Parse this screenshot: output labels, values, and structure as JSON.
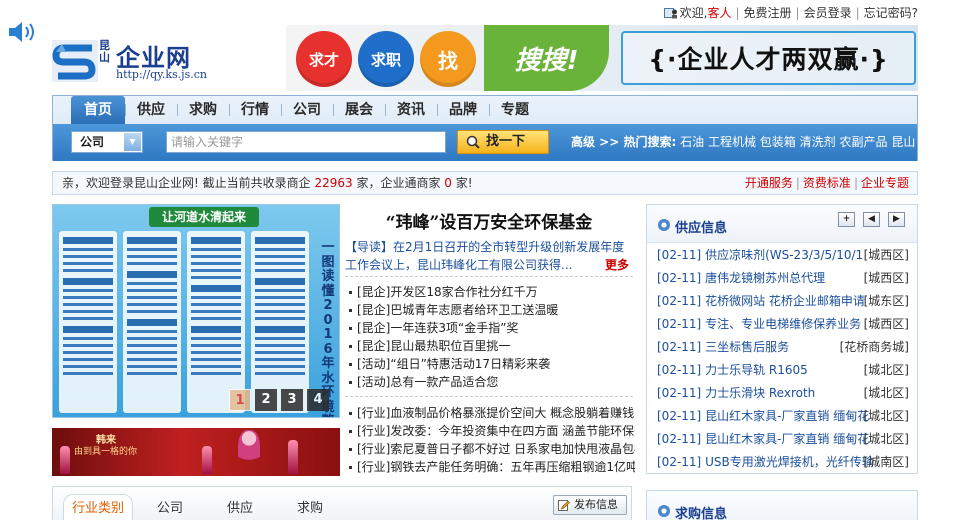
{
  "toplinks": {
    "welcome": "欢迎,",
    "guest": "客人",
    "register": "免费注册",
    "login": "会员登录",
    "forgot": "忘记密码?"
  },
  "logo": {
    "cn_small": "昆山",
    "cn_big": "企业网",
    "url": "http://qy.ks.js.cn"
  },
  "banner": {
    "c1": "求才",
    "c2": "求职",
    "c3": "找",
    "big": "搜搜!",
    "slogan": "{·企业人才两双赢·}"
  },
  "nav": {
    "tabs": [
      "首页",
      "供应",
      "求购",
      "行情",
      "公司",
      "展会",
      "资讯",
      "品牌",
      "专题"
    ],
    "select_value": "公司",
    "search_placeholder": "请输入关键字",
    "search_button": "找一下",
    "hot_label": "高级 >> 热门搜索:",
    "hot_keywords": [
      "石油",
      "工程机械",
      "包装箱",
      "清洗剂",
      "农副产品",
      "昆山"
    ]
  },
  "welcome": {
    "text1": "亲，欢迎登录昆山企业网!  截止当前共收录商企 ",
    "count1": "22963",
    "text2": " 家，企业通商家 ",
    "count2": "0",
    "text3": " 家!",
    "link1": "开通服务",
    "link2": "资费标准",
    "link3": "企业专题"
  },
  "photo": {
    "title": "让河道水清起来",
    "vertical": "一图读懂2016年水环境整治",
    "pages": [
      "1",
      "2",
      "3",
      "4"
    ]
  },
  "ad": {
    "t1": "韩来",
    "t2": "由到具一格的你"
  },
  "news": {
    "headline": "“玮峰”设百万安全环保基金",
    "lead_tag": "【导读】",
    "lead": "在2月1日召开的全市转型升级创新发展年度工作会议上，昆山玮峰化工有限公司获得...",
    "more": "更多",
    "list1": [
      "[昆企]开发区18家合作社分红千万",
      "[昆企]巴城青年志愿者给环卫工送温暖",
      "[昆企]一年连获3项“金手指”奖",
      "[昆企]昆山最热职位百里挑一",
      "[活动]“组日”特惠活动17日精彩来袭",
      "[活动]总有一款产品适合您"
    ],
    "list2": [
      "[行业]血液制品价格暴涨提价空间大 概念股躺着赚钱",
      "[行业]发改委：今年投资集中在四方面 涵盖节能环保等",
      "[行业]索尼夏普日子都不好过 日系家电加快甩液晶包袱",
      "[行业]钢铁去产能任务明确：五年再压缩粗钢逾1亿吨"
    ]
  },
  "bottom_tabs": {
    "tabs": [
      "行业类别",
      "公司",
      "供应",
      "求购"
    ],
    "post": "发布信息"
  },
  "supply": {
    "title": "供应信息",
    "controls": [
      "+",
      "◀",
      "▶"
    ],
    "rows": [
      {
        "date": "[02-11]",
        "title": "供应凉味剂(WS-23/3/5/10/1",
        "area": "[城西区]"
      },
      {
        "date": "[02-11]",
        "title": "唐伟龙镜榭苏州总代理",
        "area": "[城西区]"
      },
      {
        "date": "[02-11]",
        "title": "花桥微网站 花桥企业邮箱申请",
        "area": "[城东区]"
      },
      {
        "date": "[02-11]",
        "title": "专注、专业电梯维修保养业务",
        "area": "[城西区]"
      },
      {
        "date": "[02-11]",
        "title": "三坐标售后服务",
        "area": "[花桥商务城]"
      },
      {
        "date": "[02-11]",
        "title": "力士乐导轨 R1605",
        "area": "[城北区]"
      },
      {
        "date": "[02-11]",
        "title": "力士乐滑块 Rexroth",
        "area": "[城北区]"
      },
      {
        "date": "[02-11]",
        "title": "昆山红木家具-厂家直销 缅甸花",
        "area": "[城北区]"
      },
      {
        "date": "[02-11]",
        "title": "昆山红木家具-厂家直销 缅甸花",
        "area": "[城北区]"
      },
      {
        "date": "[02-11]",
        "title": "USB专用激光焊接机，光纤传输",
        "area": "[城南区]"
      }
    ]
  },
  "purchase": {
    "title": "求购信息"
  },
  "colors": {
    "brand_blue": "#1b3f8f",
    "nav_blue": "#2f78c2",
    "accent_red": "#c00000",
    "accent_orange": "#e06000"
  }
}
